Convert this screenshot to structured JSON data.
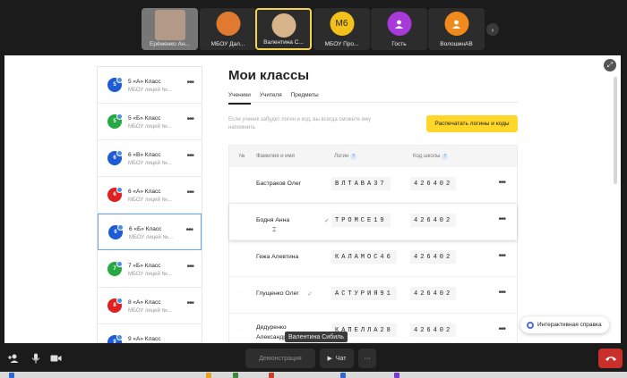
{
  "participants": [
    {
      "name": "Ерёменко Ан...",
      "avatar": "",
      "color": "#8a7a70",
      "photo": true
    },
    {
      "name": "МБОУ Дал...",
      "avatar": "",
      "color": "#e07a30",
      "photo": false
    },
    {
      "name": "Валентина С...",
      "avatar": "",
      "color": "#c9a070",
      "photo": false,
      "active": true
    },
    {
      "name": "МБОУ Про...",
      "avatar": "М6",
      "color": "#f2c21b",
      "photo": false
    },
    {
      "name": "Гость",
      "avatar": "",
      "color": "#a73ad8",
      "photo": false
    },
    {
      "name": "ВолошинАВ",
      "avatar": "",
      "color": "#f08a1c",
      "photo": false
    }
  ],
  "classes": [
    {
      "badge": "5",
      "name": "5 «А» Класс",
      "school": "МБОУ лицей №...",
      "color": "#1e5bd6"
    },
    {
      "badge": "5",
      "name": "5 «Б» Класс",
      "school": "МБОУ лицей №...",
      "color": "#28a745"
    },
    {
      "badge": "6",
      "name": "6 «В» Класс",
      "school": "МБОУ лицей №...",
      "color": "#1e5bd6"
    },
    {
      "badge": "6",
      "name": "6 «А» Класс",
      "school": "МБОУ лицей №...",
      "color": "#e02020"
    },
    {
      "badge": "6",
      "name": "6 «Б» Класс",
      "school": "МБОУ лицей №...",
      "color": "#1e5bd6",
      "selected": true
    },
    {
      "badge": "7",
      "name": "7 «Б» Класс",
      "school": "МБОУ лицей №...",
      "color": "#28a745"
    },
    {
      "badge": "8",
      "name": "8 «А» Класс",
      "school": "МБОУ лицей №...",
      "color": "#e02020"
    },
    {
      "badge": "9",
      "name": "9 «А» Класс",
      "school": "",
      "color": "#1e5bd6"
    }
  ],
  "main": {
    "title": "Мои классы",
    "tabs": [
      "Ученики",
      "Учителя",
      "Предметы"
    ],
    "hint": "Если ученик забудет логин и код, вы всегда сможете ему напомнить",
    "print_button": "Распечатать логины и коды"
  },
  "table": {
    "headers": {
      "num": "№",
      "name": "Фамилия и имя",
      "login": "Логин",
      "code": "Код школы"
    },
    "rows": [
      {
        "name": "Бастраков Олег",
        "login": "ВЛТАВА37",
        "code": "426402"
      },
      {
        "name": "Бодня Анна",
        "login": "ТРОМСЕ19",
        "code": "426402"
      },
      {
        "name": "Гежа Алевтина",
        "login": "КАЛАМОС46",
        "code": "426402"
      },
      {
        "name": "Глущенко Олег",
        "login": "АСТУРИЯ91",
        "code": "426402"
      },
      {
        "name": "Дедуренко Александр",
        "login": "КАПЕЛЛА28",
        "code": "426402"
      }
    ]
  },
  "help_button": "Интерактивная справка",
  "bottom": {
    "demo": "Демонстрация",
    "chat": "Чат",
    "more": "···",
    "speaker": "Валентина Сибиль"
  },
  "icons": {
    "expand": "expand-icon",
    "mic": "microphone-icon",
    "cam": "camera-icon",
    "add": "add-participant-icon",
    "hangup": "hangup-icon"
  }
}
